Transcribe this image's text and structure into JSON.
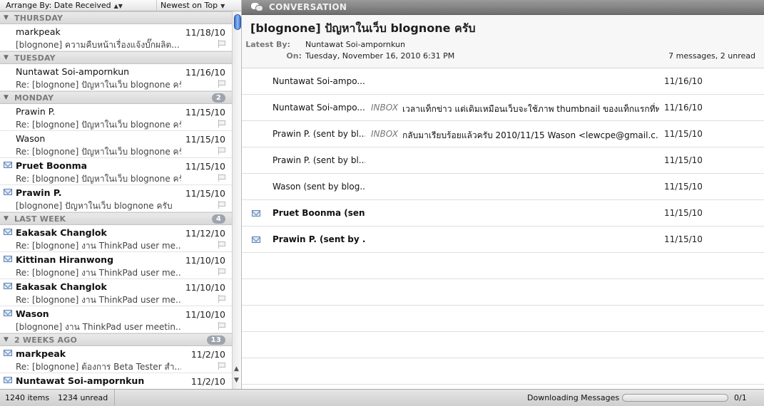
{
  "sort_bar": {
    "arrange_label": "Arrange By: Date Received",
    "order_label": "Newest on Top"
  },
  "message_list": {
    "groups": [
      {
        "name": "THURSDAY",
        "count": ""
      },
      {
        "name": "TUESDAY",
        "count": ""
      },
      {
        "name": "MONDAY",
        "count": "2"
      },
      {
        "name": "LAST WEEK",
        "count": "4"
      },
      {
        "name": "2 WEEKS AGO",
        "count": "13"
      }
    ],
    "messages": [
      {
        "from": "markpeak",
        "date": "11/18/10",
        "subject": "[blognone] ความคืบหน้าเรื่องแจ้งบั๊กผลิต...",
        "unread": false
      },
      {
        "from": "Nuntawat Soi-ampornkun",
        "date": "11/16/10",
        "subject": "Re: [blognone] ปัญหาในเว็บ blognone ครับ",
        "unread": false
      },
      {
        "from": "Prawin P.",
        "date": "11/15/10",
        "subject": "Re: [blognone] ปัญหาในเว็บ blognone ครับ",
        "unread": false
      },
      {
        "from": "Wason",
        "date": "11/15/10",
        "subject": "Re: [blognone] ปัญหาในเว็บ blognone ครับ",
        "unread": false
      },
      {
        "from": "Pruet Boonma",
        "date": "11/15/10",
        "subject": "Re: [blognone] ปัญหาในเว็บ blognone ครับ",
        "unread": true
      },
      {
        "from": "Prawin P.",
        "date": "11/15/10",
        "subject": "[blognone] ปัญหาในเว็บ blognone ครับ",
        "unread": true
      },
      {
        "from": "Eakasak Changlok",
        "date": "11/12/10",
        "subject": "Re: [blognone] งาน ThinkPad user me...",
        "unread": true
      },
      {
        "from": "Kittinan Hiranwong",
        "date": "11/10/10",
        "subject": "Re: [blognone] งาน ThinkPad user me...",
        "unread": true
      },
      {
        "from": "Eakasak Changlok",
        "date": "11/10/10",
        "subject": "Re: [blognone] งาน ThinkPad user me...",
        "unread": true
      },
      {
        "from": "Wason",
        "date": "11/10/10",
        "subject": "[blognone] งาน ThinkPad user meetin...",
        "unread": true
      },
      {
        "from": "markpeak",
        "date": "11/2/10",
        "subject": "Re: [blognone] ต้องการ Beta Tester สำ...",
        "unread": true
      },
      {
        "from": "Nuntawat Soi-ampornkun",
        "date": "11/2/10",
        "subject": "",
        "unread": true
      }
    ]
  },
  "conversation": {
    "bar_label": "CONVERSATION",
    "title": "[blognone] ปัญหาในเว็บ blognone ครับ",
    "latest_by_label": "Latest By:",
    "latest_by": "Nuntawat Soi-ampornkun",
    "on_label": "On:",
    "on": "Tuesday, November 16, 2010 6:31 PM",
    "counts": "7 messages, 2 unread",
    "rows": [
      {
        "sender": "Nuntawat Soi-ampo...",
        "mailbox": "",
        "preview": "",
        "date": "11/16/10",
        "unread": false
      },
      {
        "sender": "Nuntawat Soi-ampo...",
        "mailbox": "INBOX",
        "preview": "เวลาแท็กข่าว แต่เดิมเหมือนเว็บจะใช้ภาพ thumbnail ของแท็กแรกที่พ...",
        "date": "11/16/10",
        "unread": false
      },
      {
        "sender": "Prawin P. (sent by bl...",
        "mailbox": "INBOX",
        "preview": "กลับมาเรียบร้อยแล้วครับ 2010/11/15 Wason <lewcpe@gmail.c...",
        "date": "11/15/10",
        "unread": false
      },
      {
        "sender": "Prawin P. (sent by bl...",
        "mailbox": "",
        "preview": "",
        "date": "11/15/10",
        "unread": false
      },
      {
        "sender": "Wason (sent by blog...",
        "mailbox": "",
        "preview": "",
        "date": "11/15/10",
        "unread": false
      },
      {
        "sender": "Pruet Boonma (sen...",
        "mailbox": "",
        "preview": "",
        "date": "11/15/10",
        "unread": true
      },
      {
        "sender": "Prawin P. (sent by ...",
        "mailbox": "",
        "preview": "",
        "date": "11/15/10",
        "unread": true
      }
    ]
  },
  "status_bar": {
    "items": "1240 items",
    "unread": "1234 unread",
    "activity": "Downloading Messages",
    "progress_fraction": 0.0,
    "progress_count": "0/1"
  },
  "icons": {
    "unread_marker": "envelope-icon",
    "flag": "flag-icon",
    "disclosure": "disclosure-triangle-icon",
    "conversation": "speech-bubbles-icon"
  },
  "colors": {
    "accent_blue": "#3b6fcf",
    "group_header_text": "#7b7b7b",
    "badge": "#9da4ad"
  }
}
